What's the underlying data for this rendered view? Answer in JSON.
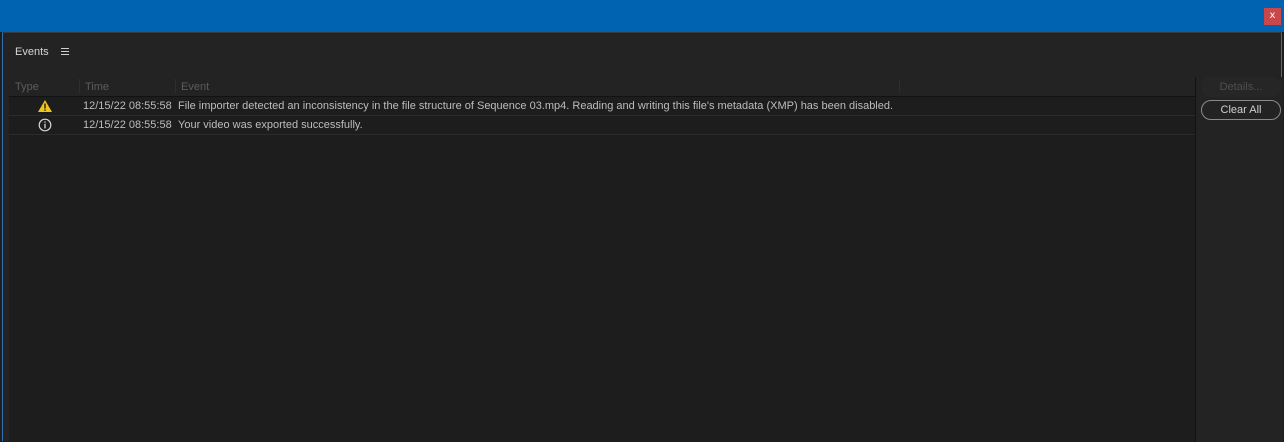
{
  "window": {
    "close_glyph": "x"
  },
  "panel": {
    "title": "Events"
  },
  "columns": {
    "type": "Type",
    "time": "Time",
    "event": "Event"
  },
  "events": [
    {
      "type": "warning",
      "time": "12/15/22 08:55:58",
      "message": "File importer detected an inconsistency in the file structure of Sequence 03.mp4. Reading and writing this file's metadata (XMP) has been disabled."
    },
    {
      "type": "info",
      "time": "12/15/22 08:55:58",
      "message": "Your video was exported successfully."
    }
  ],
  "buttons": {
    "details": "Details...",
    "clear_all": "Clear All"
  },
  "colors": {
    "titlebar": "#0063b1",
    "close": "#c7474a",
    "warning": "#f0c419",
    "panel": "#232323"
  },
  "icons": {
    "menu": "hamburger-icon",
    "warning": "warning-icon",
    "info": "info-icon",
    "close": "close-icon"
  }
}
